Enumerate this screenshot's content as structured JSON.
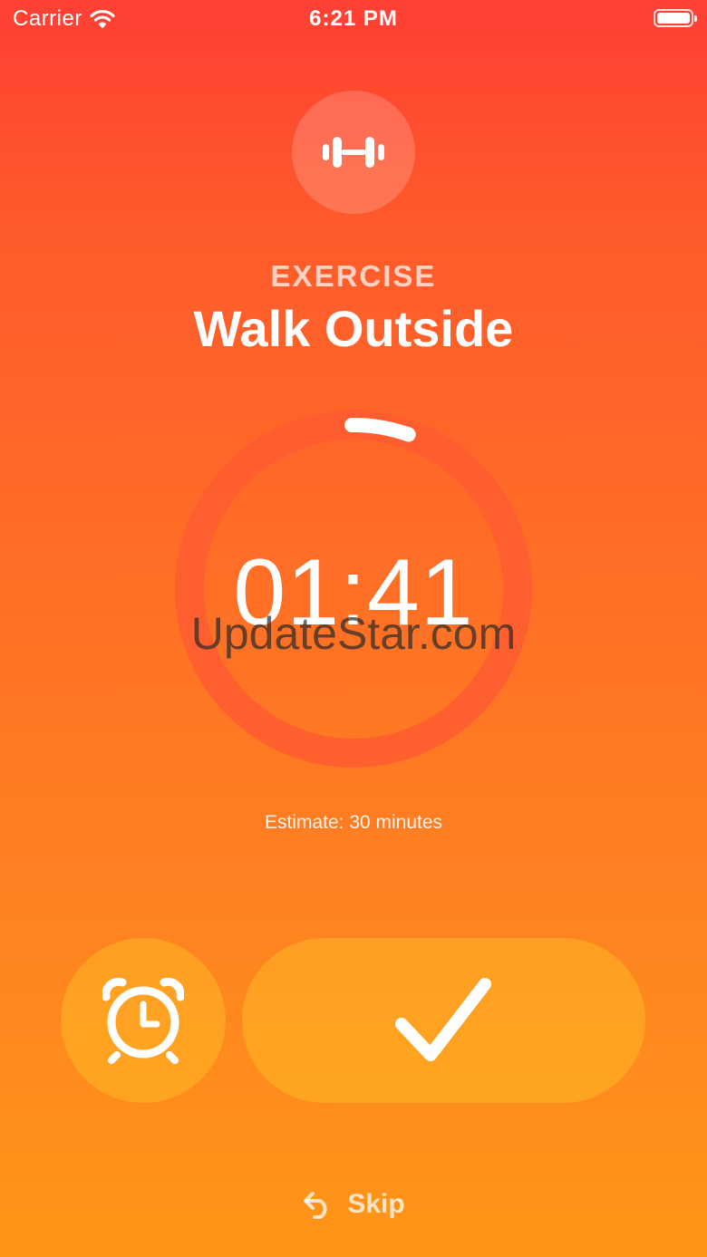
{
  "status_bar": {
    "carrier": "Carrier",
    "time": "6:21 PM",
    "wifi_icon": "wifi-icon",
    "battery_icon": "battery-icon"
  },
  "task": {
    "category": "EXERCISE",
    "category_icon": "dumbbell-icon",
    "title": "Walk Outside"
  },
  "timer": {
    "elapsed": "01:41",
    "progress": 0.056,
    "estimate": "Estimate: 30 minutes"
  },
  "watermark": "UpdateStar.com",
  "actions": {
    "snooze_icon": "alarm-clock-icon",
    "complete_icon": "checkmark-icon",
    "skip_icon": "undo-arrow-icon",
    "skip_label": "Skip"
  },
  "colors": {
    "gradient_top": "#ff3f34",
    "gradient_bottom": "#ff9618",
    "button_fill": "#ffc128",
    "text": "#ffffff"
  }
}
